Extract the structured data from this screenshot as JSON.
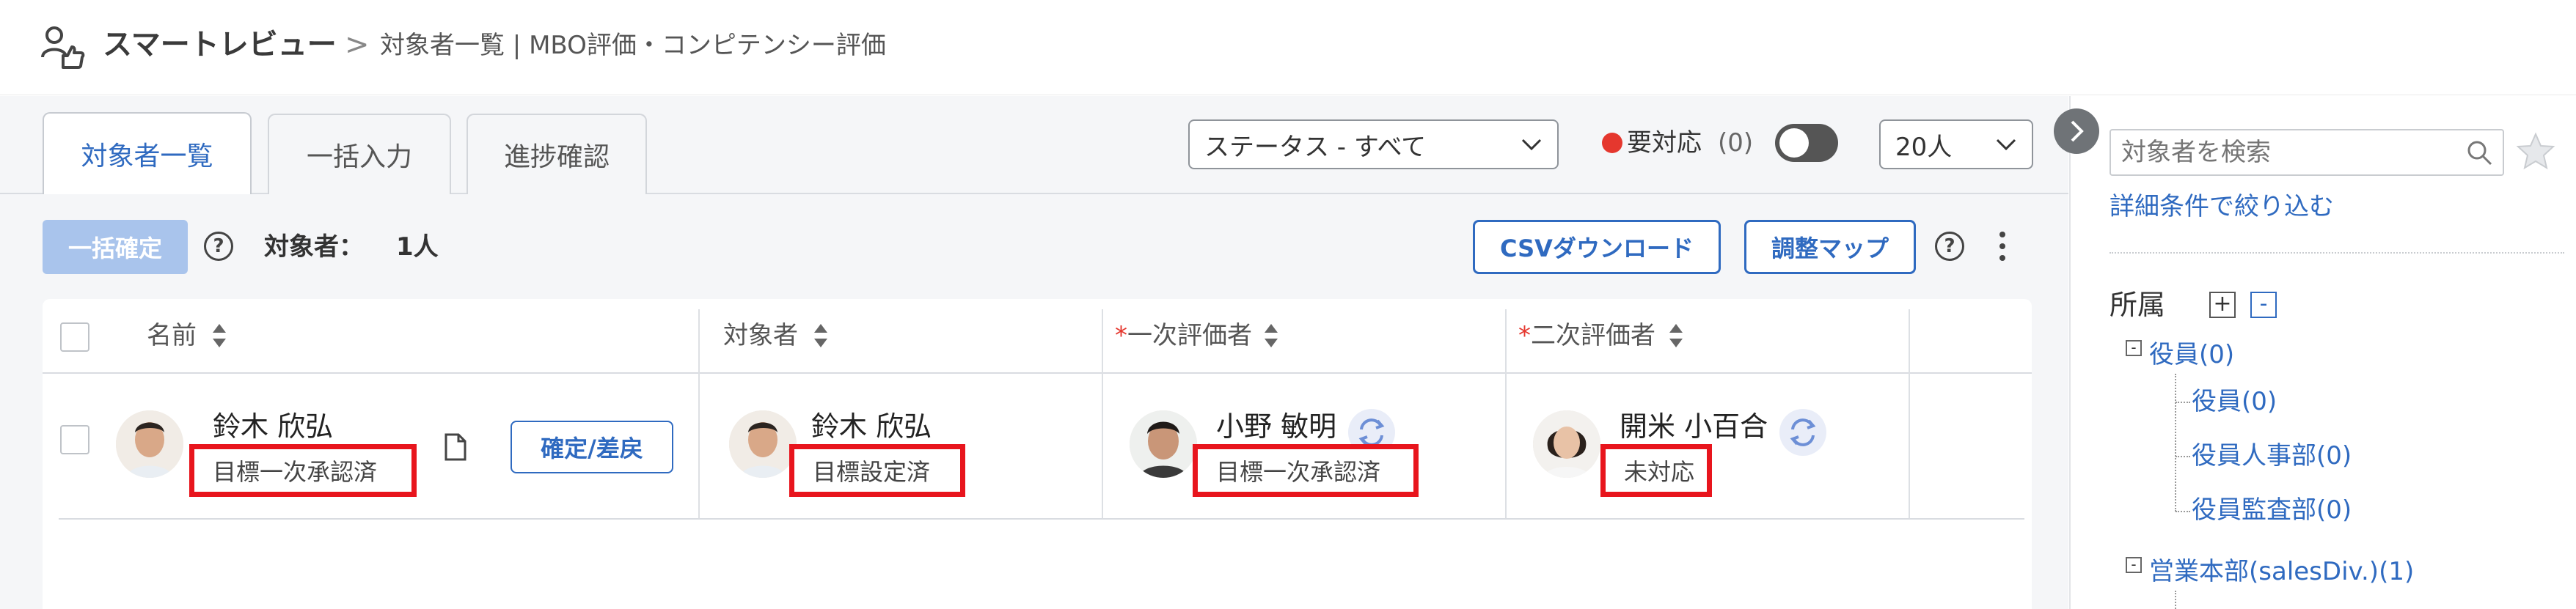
{
  "header": {
    "app_title": "スマートレビュー",
    "breadcrumb_separator": ">",
    "breadcrumb_page": "対象者一覧 | MBO評価・コンピテンシー評価"
  },
  "tabs": [
    {
      "label": "対象者一覧",
      "active": true
    },
    {
      "label": "一括入力",
      "active": false
    },
    {
      "label": "進捗確認",
      "active": false
    }
  ],
  "filters": {
    "status_select": "ステータス - すべて",
    "needs_action_label": "要対応",
    "needs_action_count": "(0)",
    "needs_action_dot_color": "#e5372e",
    "page_size_select": "20人"
  },
  "toolbar": {
    "bulk_confirm_label": "一括確定",
    "help_symbol": "?",
    "target_count_label": "対象者：",
    "target_count_value": "1人",
    "csv_download_label": "CSVダウンロード",
    "adjust_map_label": "調整マップ"
  },
  "table": {
    "columns": [
      {
        "label": "名前",
        "required": false
      },
      {
        "label": "対象者",
        "required": false
      },
      {
        "label": "一次評価者",
        "required": true,
        "required_mark": "*"
      },
      {
        "label": "二次評価者",
        "required": true,
        "required_mark": "*"
      }
    ],
    "rows": [
      {
        "name": "鈴木 欣弘",
        "name_status": "目標一次承認済",
        "action_button": "確定/差戻",
        "target_name": "鈴木 欣弘",
        "target_status": "目標設定済",
        "first_evaluator_name": "小野 敏明",
        "first_evaluator_status": "目標一次承認済",
        "second_evaluator_name": "開米 小百合",
        "second_evaluator_status": "未対応"
      }
    ]
  },
  "right_panel": {
    "search_placeholder": "対象者を検索",
    "detail_filter_link": "詳細条件で絞り込む",
    "affiliation_label": "所属",
    "expand_all_symbol": "+",
    "collapse_all_symbol": "-",
    "tree": {
      "root1": {
        "label": "役員(0)",
        "toggle": "-"
      },
      "children1": [
        "役員(0)",
        "役員人事部(0)",
        "役員監査部(0)"
      ],
      "root2": {
        "label": "営業本部(salesDiv.)(1)",
        "toggle": "-"
      }
    }
  },
  "colors": {
    "accent": "#2f6ac0",
    "highlight_border": "#e8151d",
    "disabled_button": "#a9c4ec"
  }
}
